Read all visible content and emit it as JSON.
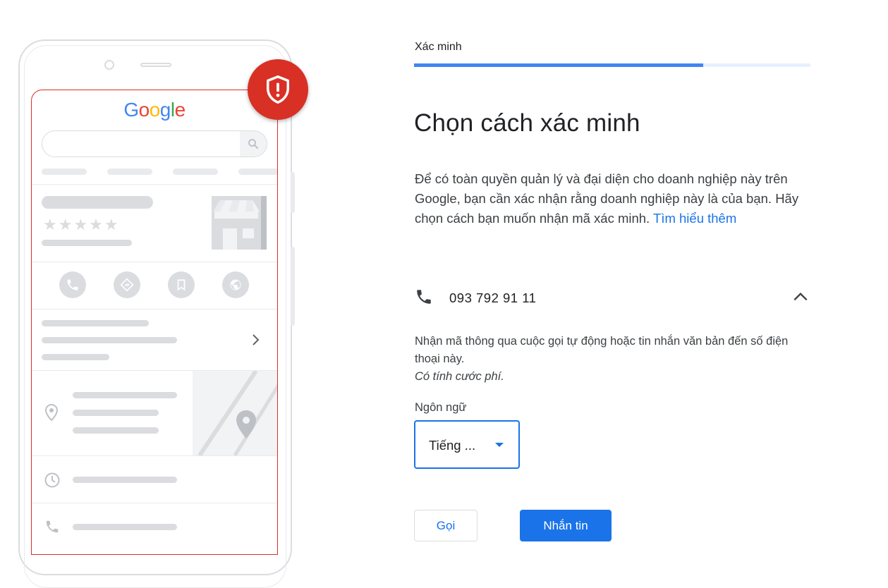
{
  "illustration": {
    "logo_text": "Google",
    "logo_colors": [
      "#4285F4",
      "#EA4335",
      "#FBBC05",
      "#4285F4",
      "#34A853",
      "#EA4335"
    ],
    "stars": "★★★★★",
    "alert_icon": "shield-alert-icon",
    "action_icons": [
      "phone-icon",
      "directions-icon",
      "bookmark-icon",
      "globe-icon"
    ]
  },
  "header": {
    "step_label": "Xác minh",
    "progress_fraction": 0.73
  },
  "main": {
    "title": "Chọn cách xác minh",
    "intro_text": "Để có toàn quyền quản lý và đại diện cho doanh nghiệp này trên Google, bạn cần xác nhận rằng doanh nghiệp này là của bạn. Hãy chọn cách bạn muốn nhận mã xác minh. ",
    "learn_more_link": "Tìm hiểu thêm"
  },
  "phone_option": {
    "icon": "phone-icon",
    "number": "093 792 91 11",
    "expanded": true,
    "description": "Nhận mã thông qua cuộc gọi tự động hoặc tin nhắn văn bản đến số điện thoại này.",
    "fee_note": "Có tính cước phí."
  },
  "language": {
    "label": "Ngôn ngữ",
    "selected": "Tiếng ..."
  },
  "actions": {
    "call_label": "Gọi",
    "text_label": "Nhắn tin"
  },
  "colors": {
    "accent": "#1a73e8",
    "alert": "#d93025",
    "progress": "#4285f4"
  }
}
